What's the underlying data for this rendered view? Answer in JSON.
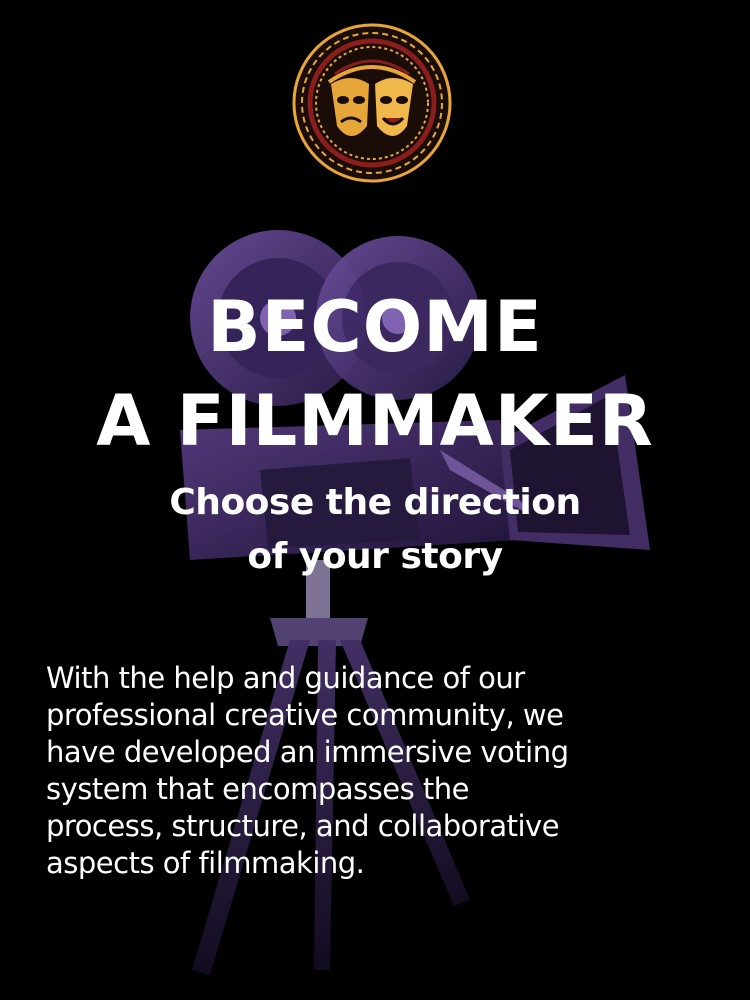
{
  "logo": {
    "name": "theater-masks-logo-icon",
    "colors": {
      "primary": "#e6a63a",
      "dark": "#1a0c06",
      "accent": "#8b1d1d"
    }
  },
  "background": {
    "illustration": "vintage-film-camera-icon",
    "accent": "#5a3e8a",
    "backdrop": "#000000"
  },
  "headline": {
    "line1": "BECOME",
    "line2": "A FILMMAKER"
  },
  "subheadline": {
    "line1": "Choose the direction",
    "line2": "of your story"
  },
  "body": {
    "lines": [
      "With the help and guidance of our",
      "professional creative community, we",
      "have developed an immersive voting",
      "system that encompasses the",
      "process, structure, and collaborative",
      "aspects of filmmaking."
    ]
  }
}
